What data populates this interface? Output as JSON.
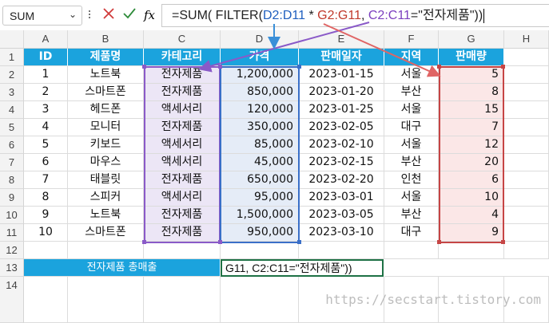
{
  "formula_bar": {
    "name_box": "SUM",
    "name_box_dropdown": "⌄",
    "cancel_icon": "close-icon",
    "enter_icon": "check-icon",
    "fx_label": "fx",
    "formula_parts": [
      {
        "text": "=SUM( FILTER(",
        "color": "#222222"
      },
      {
        "text": "D2:D11",
        "color": "#1f5fbf"
      },
      {
        "text": " * ",
        "color": "#222222"
      },
      {
        "text": "G2:G11",
        "color": "#c0392b"
      },
      {
        "text": ", ",
        "color": "#222222"
      },
      {
        "text": "C2:C11",
        "color": "#7b3fbf"
      },
      {
        "text": "=\"전자제품\"))",
        "color": "#222222"
      }
    ]
  },
  "columns": [
    "A",
    "B",
    "C",
    "D",
    "E",
    "F",
    "G",
    "H"
  ],
  "header_row": [
    "ID",
    "제품명",
    "카테고리",
    "가격",
    "판매일자",
    "지역",
    "판매량"
  ],
  "rows": [
    [
      "1",
      "노트북",
      "전자제품",
      "1,200,000",
      "2023-01-15",
      "서울",
      "5"
    ],
    [
      "2",
      "스마트폰",
      "전자제품",
      "850,000",
      "2023-01-20",
      "부산",
      "8"
    ],
    [
      "3",
      "헤드폰",
      "액세서리",
      "120,000",
      "2023-01-25",
      "서울",
      "15"
    ],
    [
      "4",
      "모니터",
      "전자제품",
      "350,000",
      "2023-02-05",
      "대구",
      "7"
    ],
    [
      "5",
      "키보드",
      "액세서리",
      "85,000",
      "2023-02-10",
      "서울",
      "12"
    ],
    [
      "6",
      "마우스",
      "액세서리",
      "45,000",
      "2023-02-15",
      "부산",
      "20"
    ],
    [
      "7",
      "태블릿",
      "전자제품",
      "650,000",
      "2023-02-20",
      "인천",
      "6"
    ],
    [
      "8",
      "스피커",
      "액세서리",
      "95,000",
      "2023-03-01",
      "서울",
      "10"
    ],
    [
      "9",
      "노트북",
      "전자제품",
      "1,500,000",
      "2023-03-05",
      "부산",
      "4"
    ],
    [
      "10",
      "스마트폰",
      "전자제품",
      "950,000",
      "2023-03-10",
      "대구",
      "9"
    ]
  ],
  "row_numbers": [
    "1",
    "2",
    "3",
    "4",
    "5",
    "6",
    "7",
    "8",
    "9",
    "10",
    "11",
    "12",
    "13",
    "14"
  ],
  "summary": {
    "label": "전자제품 총매출",
    "edit_text": "G11, C2:C11=\"전자제품\"))"
  },
  "colors": {
    "header_blue": "#1ba3dd",
    "range_purple": "#7b3fbf",
    "range_blue": "#1f5fbf",
    "range_red": "#c0392b",
    "selection_green": "#1e7145"
  },
  "watermark": "https://secstart.tistory.com"
}
